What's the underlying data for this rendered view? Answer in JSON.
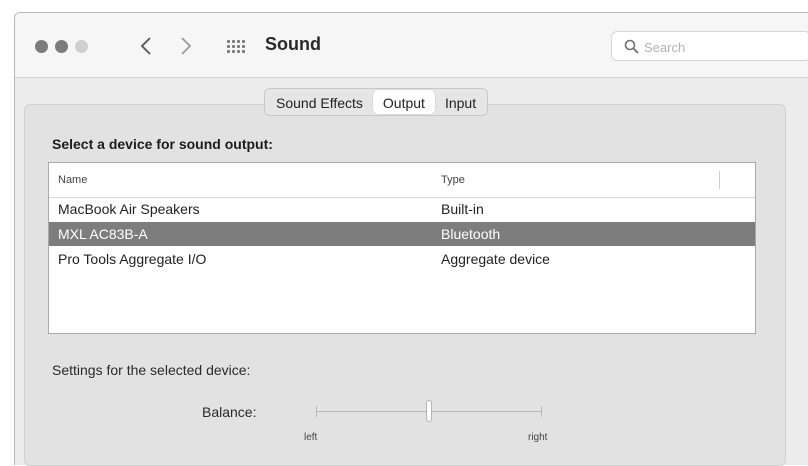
{
  "window": {
    "title": "Sound",
    "search_placeholder": "Search"
  },
  "tabs": [
    {
      "label": "Sound Effects",
      "active": false
    },
    {
      "label": "Output",
      "active": true
    },
    {
      "label": "Input",
      "active": false
    }
  ],
  "output": {
    "heading": "Select a device for sound output:",
    "columns": {
      "name": "Name",
      "type": "Type"
    },
    "devices": [
      {
        "name": "MacBook Air Speakers",
        "type": "Built-in",
        "selected": false
      },
      {
        "name": "MXL AC83B-A",
        "type": "Bluetooth",
        "selected": true
      },
      {
        "name": "Pro Tools Aggregate I/O",
        "type": "Aggregate device",
        "selected": false
      }
    ],
    "settings_heading": "Settings for the selected device:",
    "balance": {
      "label": "Balance:",
      "min_label": "left",
      "max_label": "right",
      "value": 0.5
    }
  },
  "colors": {
    "selection": "#7d7d7d",
    "window_bg": "#ececec"
  },
  "icons": [
    "back-arrow-icon",
    "forward-arrow-icon",
    "show-all-grid-icon",
    "search-icon"
  ]
}
